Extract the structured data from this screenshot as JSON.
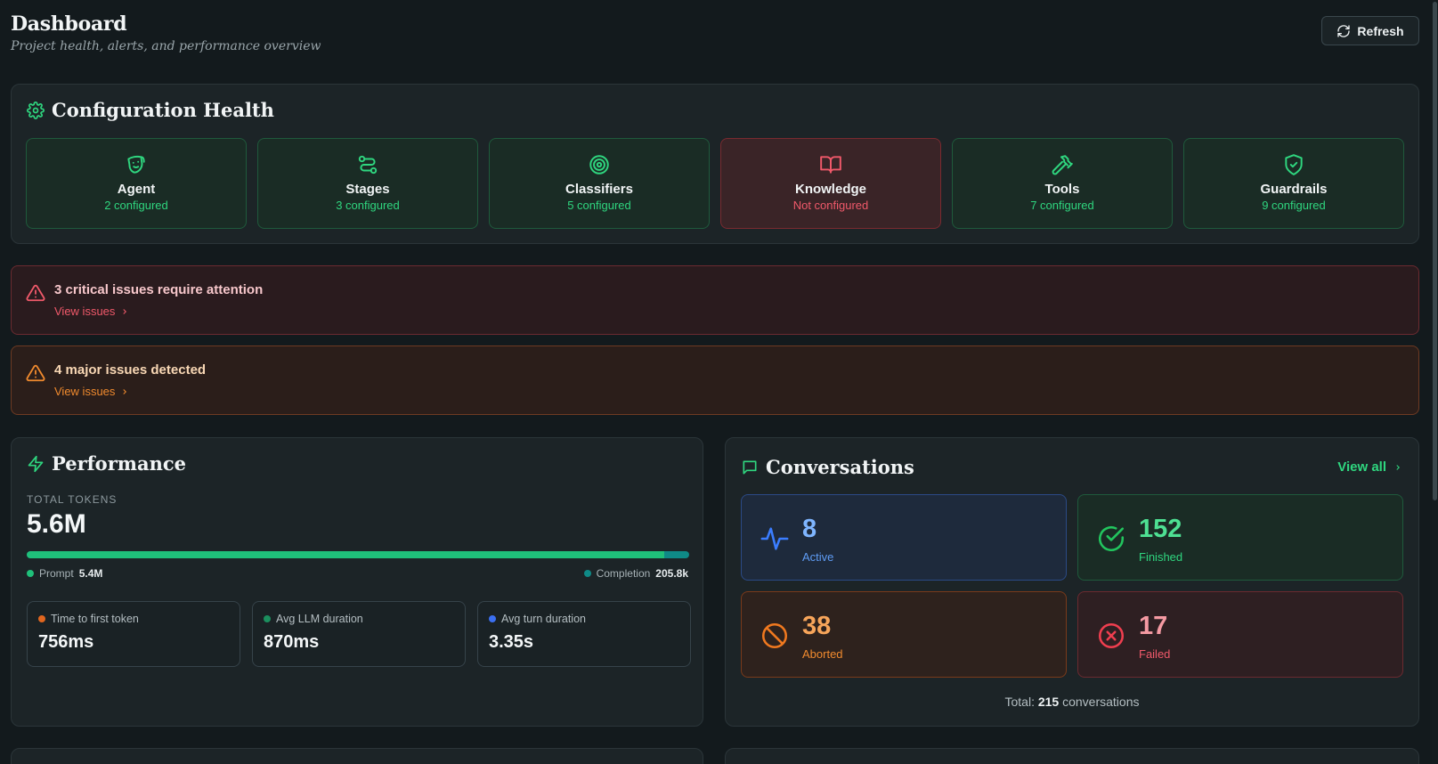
{
  "header": {
    "title": "Dashboard",
    "subtitle": "Project health, alerts, and performance overview",
    "refresh_label": "Refresh"
  },
  "config_health": {
    "title": "Configuration Health",
    "tiles": [
      {
        "name": "Agent",
        "status": "2 configured",
        "icon": "mask-icon",
        "ok": true
      },
      {
        "name": "Stages",
        "status": "3 configured",
        "icon": "route-icon",
        "ok": true
      },
      {
        "name": "Classifiers",
        "status": "5 configured",
        "icon": "target-icon",
        "ok": true
      },
      {
        "name": "Knowledge",
        "status": "Not configured",
        "icon": "book-icon",
        "ok": false
      },
      {
        "name": "Tools",
        "status": "7 configured",
        "icon": "hammer-icon",
        "ok": true
      },
      {
        "name": "Guardrails",
        "status": "9 configured",
        "icon": "shield-check-icon",
        "ok": true
      }
    ]
  },
  "alerts": {
    "critical": {
      "title": "3 critical issues require attention",
      "link": "View issues",
      "icon": "warning-triangle-icon"
    },
    "major": {
      "title": "4 major issues detected",
      "link": "View issues",
      "icon": "warning-triangle-icon"
    }
  },
  "performance": {
    "title": "Performance",
    "tokens_label": "TOTAL TOKENS",
    "tokens_total": "5.6M",
    "prompt_fraction": 0.963,
    "prompt_label": "Prompt",
    "prompt_value": "5.4M",
    "completion_label": "Completion",
    "completion_value": "205.8k",
    "metrics": [
      {
        "label": "Time to first token",
        "value": "756ms",
        "dot_color": "#e0661f"
      },
      {
        "label": "Avg LLM duration",
        "value": "870ms",
        "dot_color": "#1b8f5e"
      },
      {
        "label": "Avg turn duration",
        "value": "3.35s",
        "dot_color": "#3b6ff0"
      }
    ]
  },
  "conversations": {
    "title": "Conversations",
    "view_all": "View all",
    "tiles": {
      "active": {
        "count": "8",
        "label": "Active",
        "icon": "activity-icon"
      },
      "finished": {
        "count": "152",
        "label": "Finished",
        "icon": "check-circle-icon"
      },
      "aborted": {
        "count": "38",
        "label": "Aborted",
        "icon": "ban-icon"
      },
      "failed": {
        "count": "17",
        "label": "Failed",
        "icon": "x-circle-icon"
      }
    },
    "total_prefix": "Total:",
    "total_count": "215",
    "total_suffix": "conversations"
  },
  "colors": {
    "accent_green": "#2fd67f",
    "danger_red": "#f0596a",
    "warning_orange": "#f08a2e",
    "info_blue": "#5f9cf5"
  }
}
